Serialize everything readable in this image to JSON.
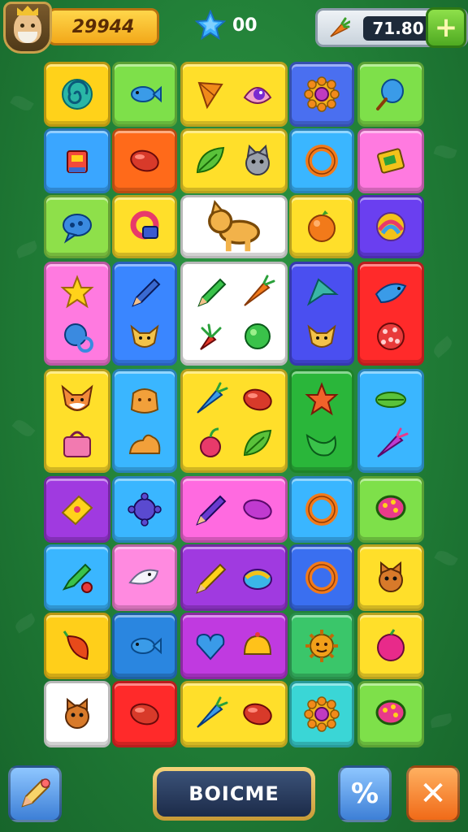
{
  "hud": {
    "coins": "29944",
    "stars": "00",
    "carrots": "71.80",
    "add_label": "+"
  },
  "actions": {
    "main_label": "BOICME",
    "percent_label": "%",
    "close_label": "✕"
  },
  "tiles": [
    {
      "name": "r1c1",
      "bg": "#ffd21a",
      "icons": [
        "swirl-candy-icon"
      ]
    },
    {
      "name": "r1c2",
      "bg": "#7ee04a",
      "icons": [
        "blue-fish-icon"
      ]
    },
    {
      "name": "r1c3",
      "bg": "#ffdf2a",
      "icons": [
        "kite-icon",
        "eye-gem-icon"
      ]
    },
    {
      "name": "r1c4",
      "bg": "#4a6ff0",
      "icons": [
        "gear-flower-icon"
      ]
    },
    {
      "name": "r1c5",
      "bg": "#7ee04a",
      "icons": [
        "blue-balloon-icon"
      ]
    },
    {
      "name": "r2c1",
      "bg": "#3aa6ff",
      "icons": [
        "robot-icon"
      ]
    },
    {
      "name": "r2c2",
      "bg": "#ff6a1a",
      "icons": [
        "red-bean-icon"
      ]
    },
    {
      "name": "r2c3",
      "bg": "#ffdf2a",
      "icons": [
        "leaf-icon",
        "gray-cat-icon"
      ]
    },
    {
      "name": "r2c4",
      "bg": "#3ab6ff",
      "icons": [
        "orange-ring-icon"
      ]
    },
    {
      "name": "r2c5",
      "bg": "#ff7ae0",
      "icons": [
        "gift-box-icon"
      ]
    },
    {
      "name": "r3c1",
      "bg": "#8ee04a",
      "icons": [
        "speech-bubble-icon"
      ]
    },
    {
      "name": "r3c2",
      "bg": "#ffdf2a",
      "icons": [
        "magnet-ring-icon"
      ]
    },
    {
      "name": "r3c3",
      "bg": "#ffffff",
      "icons": [
        "yellow-dog-icon"
      ]
    },
    {
      "name": "r3c4",
      "bg": "#ffdf2a",
      "icons": [
        "orange-fruit-icon"
      ]
    },
    {
      "name": "r3c5",
      "bg": "#6a3ff0",
      "icons": [
        "rainbow-candy-icon"
      ]
    },
    {
      "name": "r4c1",
      "bg": "#ff7ae0",
      "icons": [
        "star-icon",
        "blue-rattle-icon"
      ]
    },
    {
      "name": "r4c2",
      "bg": "#3a86ff",
      "icons": [
        "pencil-icon",
        "fox-face-icon"
      ]
    },
    {
      "name": "r4c3",
      "bg": "#ffffff",
      "icons": [
        "green-pencil-icon",
        "carrot-icon",
        "carrot-bunch-icon",
        "green-ball-icon"
      ]
    },
    {
      "name": "r4c4",
      "bg": "#4a4ff0",
      "icons": [
        "arrow-leaf-icon",
        "fox-face-icon"
      ]
    },
    {
      "name": "r4c5",
      "bg": "#ff2a2a",
      "icons": [
        "blue-bird-icon",
        "red-ball-icon"
      ]
    },
    {
      "name": "r5c1",
      "bg": "#ffdf2a",
      "icons": [
        "fox-head-icon",
        "pink-bag-icon"
      ]
    },
    {
      "name": "r5c2",
      "bg": "#3ab6ff",
      "icons": [
        "teddy-icon",
        "sleeping-cat-icon"
      ]
    },
    {
      "name": "r5c3",
      "bg": "#ffdf2a",
      "icons": [
        "blue-carrot-icon",
        "red-bean-icon",
        "cherry-icon",
        "leaf-icon"
      ]
    },
    {
      "name": "r5c4",
      "bg": "#2ab63a",
      "icons": [
        "orange-star-icon",
        "green-bird-icon"
      ]
    },
    {
      "name": "r5c5",
      "bg": "#3ab6ff",
      "icons": [
        "green-leaf-icon",
        "purple-carrot-icon"
      ]
    },
    {
      "name": "r6c1",
      "bg": "#a03ae0",
      "icons": [
        "yellow-cheese-icon"
      ]
    },
    {
      "name": "r6c2",
      "bg": "#3ab6ff",
      "icons": [
        "purple-gear-icon"
      ]
    },
    {
      "name": "r6c3",
      "bg": "#ff6ae0",
      "icons": [
        "purple-pen-icon",
        "pink-bean-icon"
      ]
    },
    {
      "name": "r6c4",
      "bg": "#3ab6ff",
      "icons": [
        "orange-ring-icon"
      ]
    },
    {
      "name": "r6c5",
      "bg": "#7ee04a",
      "icons": [
        "dotted-bubble-icon"
      ]
    },
    {
      "name": "r7c1",
      "bg": "#3ab6ff",
      "icons": [
        "pencil-cherry-icon"
      ]
    },
    {
      "name": "r7c2",
      "bg": "#ff8ae0",
      "icons": [
        "white-fish-icon"
      ]
    },
    {
      "name": "r7c3",
      "bg": "#a03ae0",
      "icons": [
        "yellow-pencil-icon",
        "rainbow-bag-icon"
      ]
    },
    {
      "name": "r7c4",
      "bg": "#3a6ff0",
      "icons": [
        "orange-ring-icon"
      ]
    },
    {
      "name": "r7c5",
      "bg": "#ffdf2a",
      "icons": [
        "cat-face-icon"
      ]
    },
    {
      "name": "r8c1",
      "bg": "#ffcf1a",
      "icons": [
        "chili-icon"
      ]
    },
    {
      "name": "r8c2",
      "bg": "#2a86e0",
      "icons": [
        "blue-fish-icon"
      ]
    },
    {
      "name": "r8c3",
      "bg": "#c03ae0",
      "icons": [
        "blue-heart-icon",
        "yellow-bell-icon"
      ]
    },
    {
      "name": "r8c4",
      "bg": "#3ac66a",
      "icons": [
        "sun-face-icon"
      ]
    },
    {
      "name": "r8c5",
      "bg": "#ffdf2a",
      "icons": [
        "pink-apple-icon"
      ]
    },
    {
      "name": "r9c1",
      "bg": "#ffffff",
      "icons": [
        "cat-face-icon"
      ]
    },
    {
      "name": "r9c2",
      "bg": "#ff2a2a",
      "icons": [
        "red-bean-icon"
      ]
    },
    {
      "name": "r9c3",
      "bg": "#ffdf2a",
      "icons": [
        "blue-carrot-icon",
        "red-bean-icon"
      ]
    },
    {
      "name": "r9c4",
      "bg": "#3ad6d6",
      "icons": [
        "gear-flower-icon"
      ]
    },
    {
      "name": "r9c5",
      "bg": "#7ee04a",
      "icons": [
        "dotted-bubble-icon"
      ]
    }
  ]
}
